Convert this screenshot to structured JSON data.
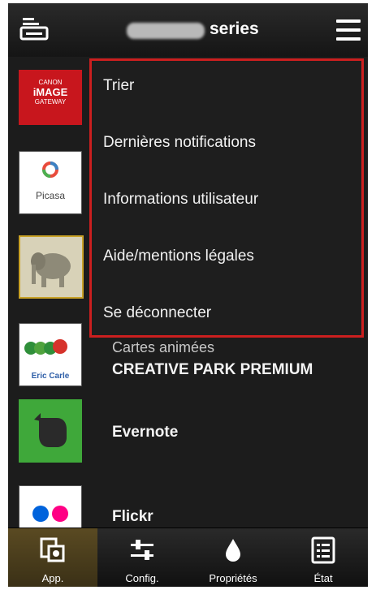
{
  "header": {
    "title": "series",
    "title_prefix_obscured": true
  },
  "menu": {
    "items": [
      {
        "label": "Trier"
      },
      {
        "label": "Dernières notifications"
      },
      {
        "label": "Informations utilisateur"
      },
      {
        "label": "Aide/mentions légales"
      },
      {
        "label": "Se déconnecter"
      }
    ],
    "highlight_color": "#cc1f1f"
  },
  "apps": {
    "canon_thumb": {
      "line1": "CANON",
      "line2": "iMAGE",
      "line3": "GATEWAY"
    },
    "picasa_thumb": {
      "name": "Picasa"
    },
    "creative_park": {
      "subtitle": "Cartes animées",
      "label": "CREATIVE PARK PREMIUM"
    },
    "creative_thumb": {
      "text": "Eric Carle"
    },
    "evernote": {
      "label": "Evernote"
    },
    "flickr": {
      "label": "Flickr"
    }
  },
  "tabs": [
    {
      "label": "App.",
      "icon": "apps-icon",
      "active": true
    },
    {
      "label": "Config.",
      "icon": "sliders-icon",
      "active": false
    },
    {
      "label": "Propriétés",
      "icon": "ink-drop-icon",
      "active": false
    },
    {
      "label": "État",
      "icon": "checklist-icon",
      "active": false
    }
  ]
}
